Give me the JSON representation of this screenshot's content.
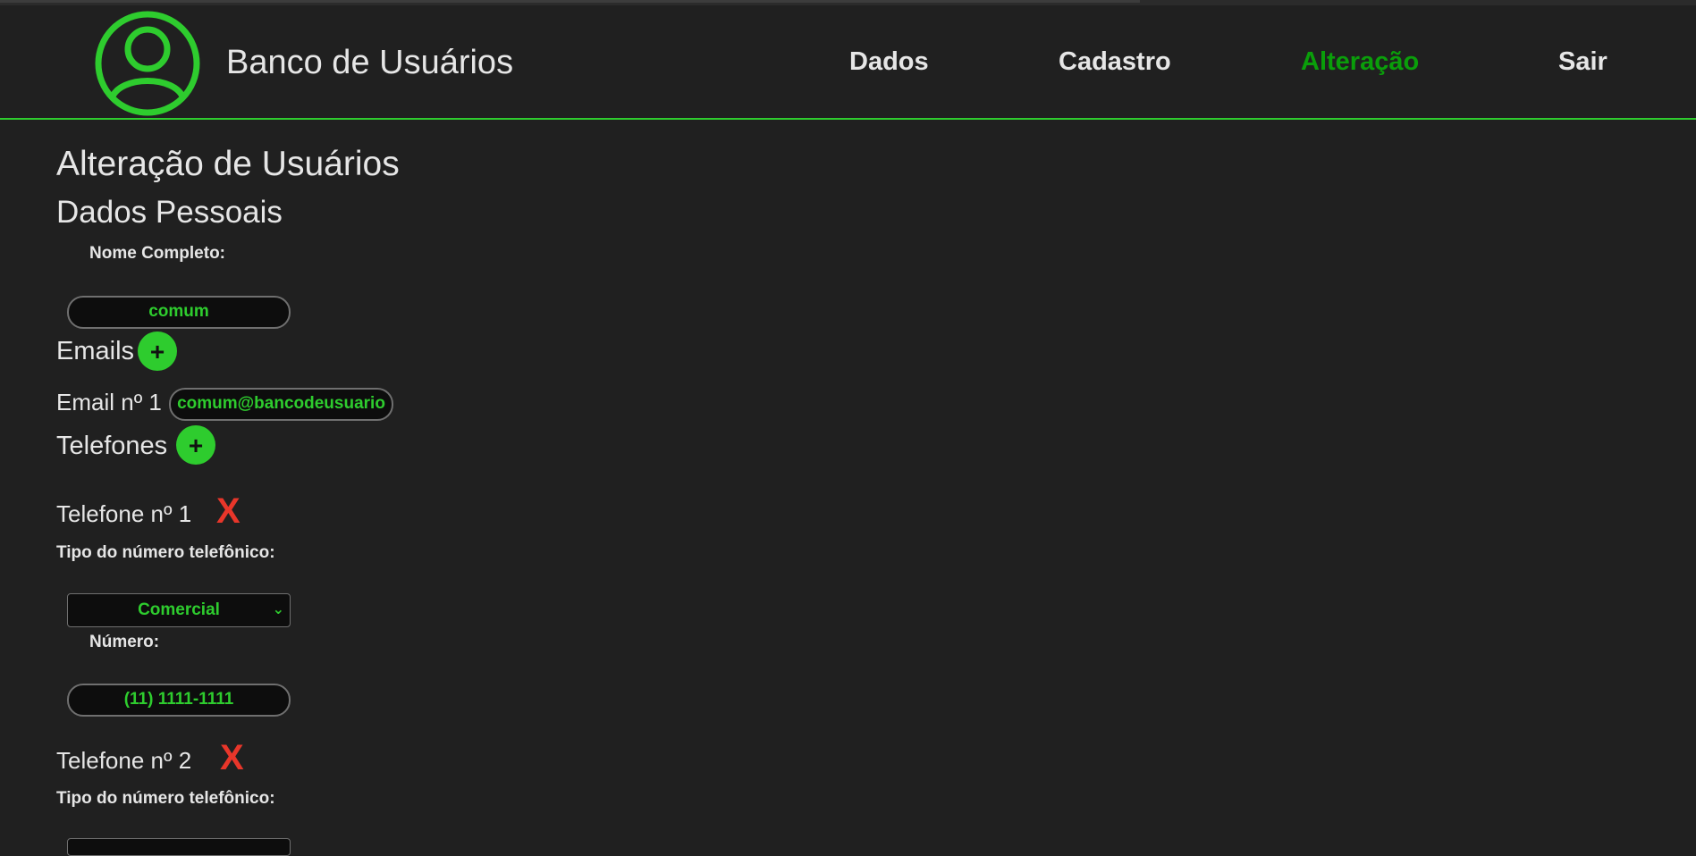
{
  "header": {
    "brand": "Banco de Usuários",
    "nav": [
      "Dados",
      "Cadastro",
      "Alteração",
      "Sair"
    ],
    "active_nav": "Alteração"
  },
  "page": {
    "title": "Alteração de Usuários",
    "section_personal": "Dados Pessoais",
    "full_name_label": "Nome Completo:",
    "full_name_value": "comum",
    "emails_title": "Emails",
    "add_icon": "+",
    "email_1_label": "Email nº 1",
    "email_1_value": "comum@bancodeusuario",
    "phones_title": "Telefones",
    "phone_1_label": "Telefone nº 1",
    "phone_type_label": "Tipo do número telefônico:",
    "phone_1_type": "Comercial",
    "number_label": "Número:",
    "phone_1_number": "(11) 1111-1111",
    "phone_2_label": "Telefone nº 2",
    "remove_icon": "X"
  },
  "colors": {
    "accent": "#2ecc2e",
    "active_nav": "#0a9e0a",
    "danger": "#e8362a",
    "background": "#202020"
  }
}
